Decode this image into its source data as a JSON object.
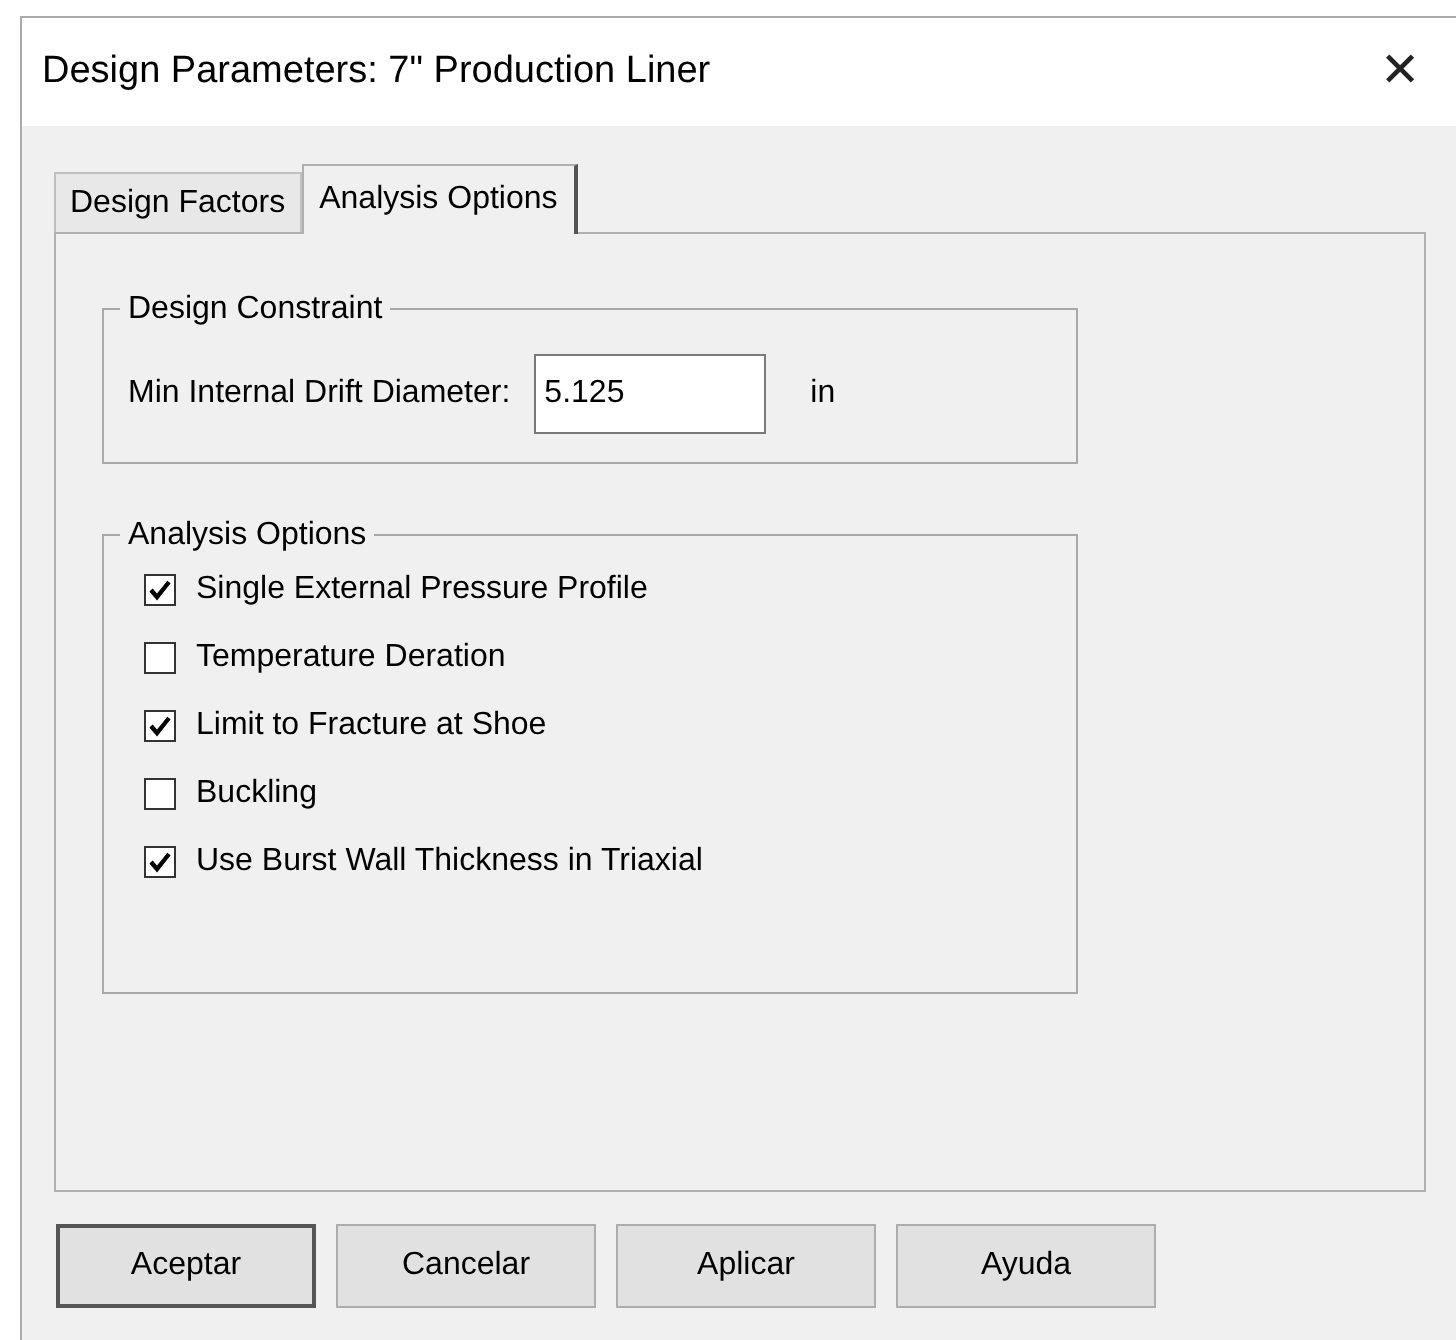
{
  "window": {
    "title": "Design Parameters: 7\" Production Liner",
    "close": "✕"
  },
  "tabs": [
    {
      "label": "Design Factors",
      "selected": false
    },
    {
      "label": "Analysis Options",
      "selected": true
    }
  ],
  "design_constraint": {
    "title": "Design Constraint",
    "label": "Min Internal Drift Diameter:",
    "value": "5.125",
    "unit": "in"
  },
  "analysis_options": {
    "title": "Analysis Options",
    "items": [
      {
        "label": "Single External Pressure Profile",
        "checked": true
      },
      {
        "label": "Temperature Deration",
        "checked": false
      },
      {
        "label": "Limit to Fracture at Shoe",
        "checked": true
      },
      {
        "label": "Buckling",
        "checked": false
      },
      {
        "label": "Use Burst Wall Thickness in Triaxial",
        "checked": true
      }
    ]
  },
  "buttons": [
    {
      "label": "Aceptar",
      "default": true
    },
    {
      "label": "Cancelar",
      "default": false
    },
    {
      "label": "Aplicar",
      "default": false
    },
    {
      "label": "Ayuda",
      "default": false
    }
  ]
}
